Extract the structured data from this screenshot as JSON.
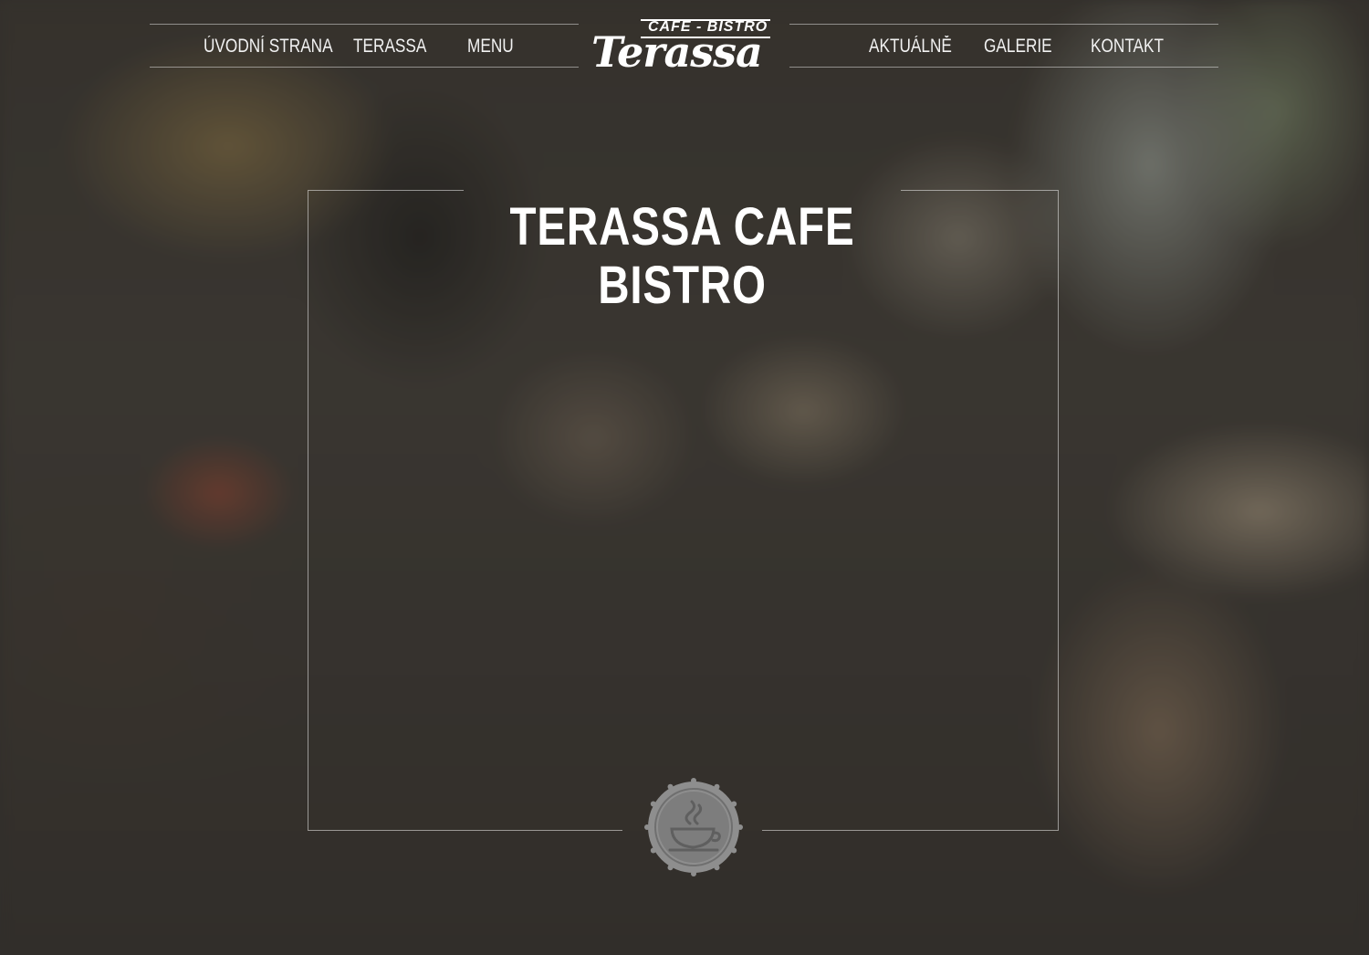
{
  "nav": {
    "left_items": [
      {
        "label": "ÚVODNÍ STRANA"
      },
      {
        "label": "TERASSA"
      },
      {
        "label": "MENU"
      }
    ],
    "right_items": [
      {
        "label": "AKTUÁLNĚ"
      },
      {
        "label": "GALERIE"
      },
      {
        "label": "KONTAKT"
      }
    ]
  },
  "logo": {
    "tagline": "CAFE - BISTRO",
    "wordmark": "Terassa"
  },
  "main": {
    "title": "TERASSA CAFE BISTRO"
  },
  "badge": {
    "icon": "coffee-cup-icon"
  },
  "colors": {
    "text": "#ffffff",
    "line": "#bfbfbf",
    "badge": "#8c8c8c"
  }
}
